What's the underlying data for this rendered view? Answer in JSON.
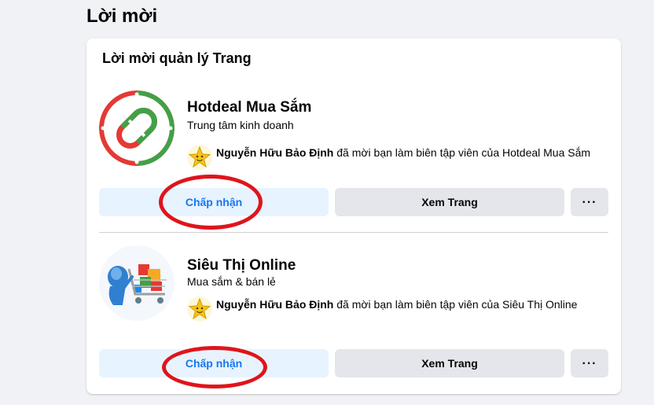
{
  "header": {
    "title": "Lời mời"
  },
  "card": {
    "title": "Lời mời quản lý Trang",
    "invites": [
      {
        "page_name": "Hotdeal Mua Sắm",
        "category": "Trung tâm kinh doanh",
        "inviter": "Nguyễn Hữu Bảo Định",
        "message": " đã mời bạn làm biên tập viên của Hotdeal Mua Sắm",
        "accept_label": "Chấp nhận",
        "view_label": "Xem Trang",
        "more_label": "···",
        "avatar_icon": "hotdeal-logo-icon"
      },
      {
        "page_name": "Siêu Thị Online",
        "category": "Mua sắm & bán lẻ",
        "inviter": "Nguyễn Hữu Bảo Định",
        "message": " đã mời bạn làm biên tập viên của Siêu Thị Online",
        "accept_label": "Chấp nhận",
        "view_label": "Xem Trang",
        "more_label": "···",
        "avatar_icon": "shopping-cart-icon"
      }
    ]
  },
  "colors": {
    "accent": "#1877f2",
    "accept_bg": "#e7f3ff",
    "secondary_bg": "#e4e6eb",
    "annotation_red": "#e0141c"
  }
}
